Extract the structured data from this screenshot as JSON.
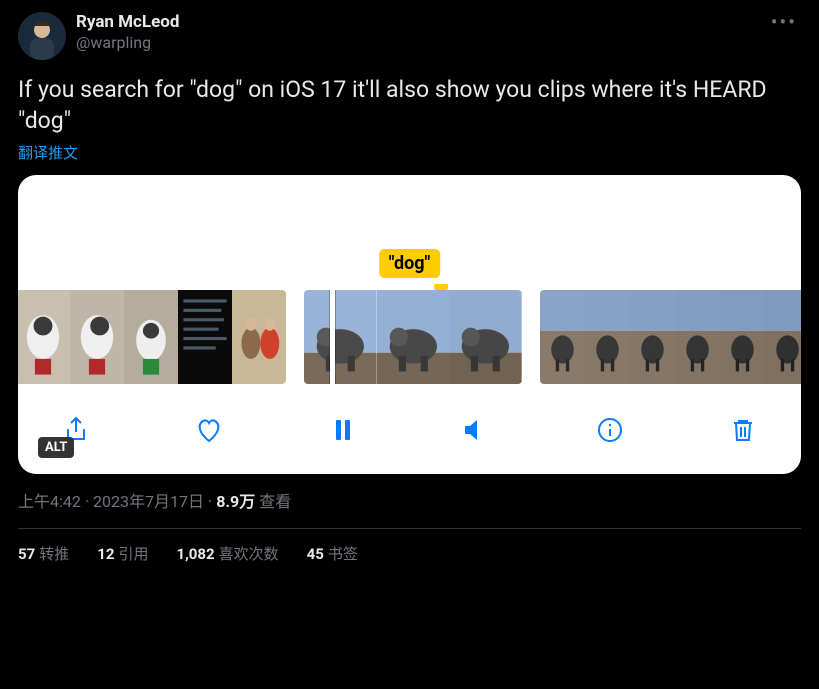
{
  "author": {
    "display_name": "Ryan McLeod",
    "handle": "@warpling"
  },
  "tweet_text": "If you search for \"dog\" on iOS 17 it'll also show you clips where it's HEARD \"dog\"",
  "translate_label": "翻译推文",
  "media": {
    "dog_label": "\"dog\"",
    "alt_badge": "ALT"
  },
  "meta": {
    "time": "上午4:42",
    "date": "2023年7月17日",
    "views_count": "8.9万",
    "views_suffix": "查看"
  },
  "stats": {
    "retweets_count": "57",
    "retweets_label": "转推",
    "quotes_count": "12",
    "quotes_label": "引用",
    "likes_count": "1,082",
    "likes_label": "喜欢次数",
    "bookmarks_count": "45",
    "bookmarks_label": "书签"
  }
}
